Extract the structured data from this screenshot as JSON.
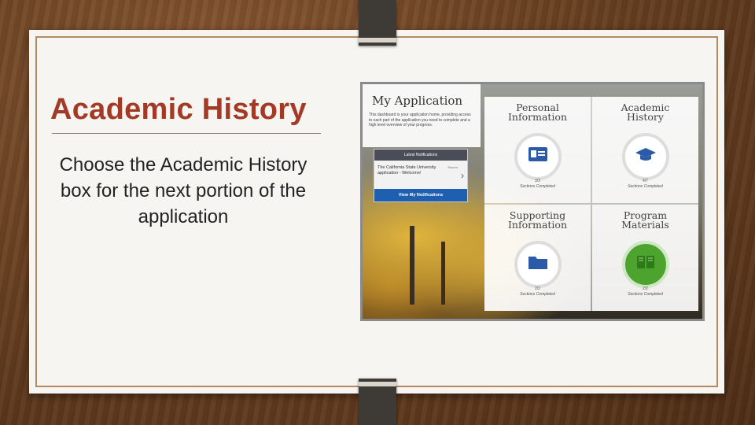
{
  "slide": {
    "title": "Academic History",
    "body": "Choose the Academic History box for the next portion of the application"
  },
  "screenshot": {
    "heading": "My Application",
    "description": "This dashboard is your application home, providing access to each part of the application you need to complete and a high level overview of your progress.",
    "notifications": {
      "header": "Latest Notifications",
      "message": "The California State University application - Welcome!",
      "tag": "Recent",
      "button": "View My Notifications"
    },
    "tiles": [
      {
        "title_line1": "Personal",
        "title_line2": "Information",
        "count": "3/3",
        "status": "Sections Completed",
        "icon": "id-card-icon"
      },
      {
        "title_line1": "Academic",
        "title_line2": "History",
        "count": "4/7",
        "status": "Sections Completed",
        "icon": "graduation-cap-icon"
      },
      {
        "title_line1": "Supporting",
        "title_line2": "Information",
        "count": "2/2",
        "status": "Sections Completed",
        "icon": "folder-icon"
      },
      {
        "title_line1": "Program",
        "title_line2": "Materials",
        "count": "2/2",
        "status": "Sections Completed",
        "icon": "book-icon"
      }
    ]
  },
  "colors": {
    "title": "#a33a26",
    "notif_button": "#1f5fb0",
    "completed_circle": "#4ca42e"
  }
}
